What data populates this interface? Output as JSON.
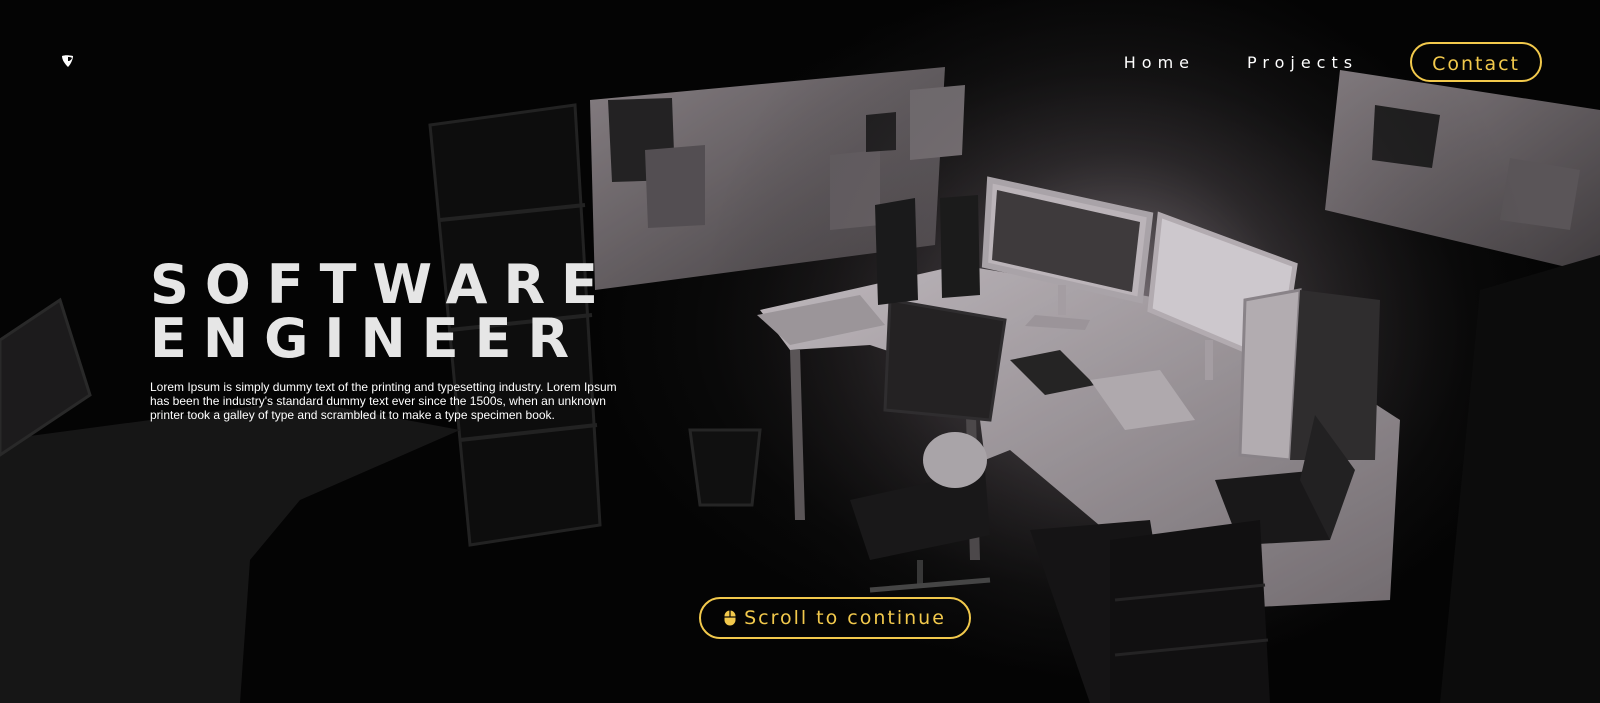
{
  "header": {
    "logo_icon": "typo3-logo-icon",
    "nav": [
      {
        "label": "Home"
      },
      {
        "label": "Projects"
      }
    ],
    "contact_label": "Contact"
  },
  "hero": {
    "title_line1": "SOFTWARE",
    "title_line2": "ENGINEER",
    "description": "Lorem Ipsum is simply dummy text of the printing and typesetting industry. Lorem Ipsum has been the industry's standard dummy text ever since the 1500s, when an unknown printer took a galley of type and scrambled it to make a type specimen book."
  },
  "scroll": {
    "icon": "mouse-icon",
    "label": "Scroll to continue"
  },
  "colors": {
    "accent": "#f2c94c",
    "background": "#050505",
    "title": "#e6e6e6",
    "text": "#ffffff"
  }
}
